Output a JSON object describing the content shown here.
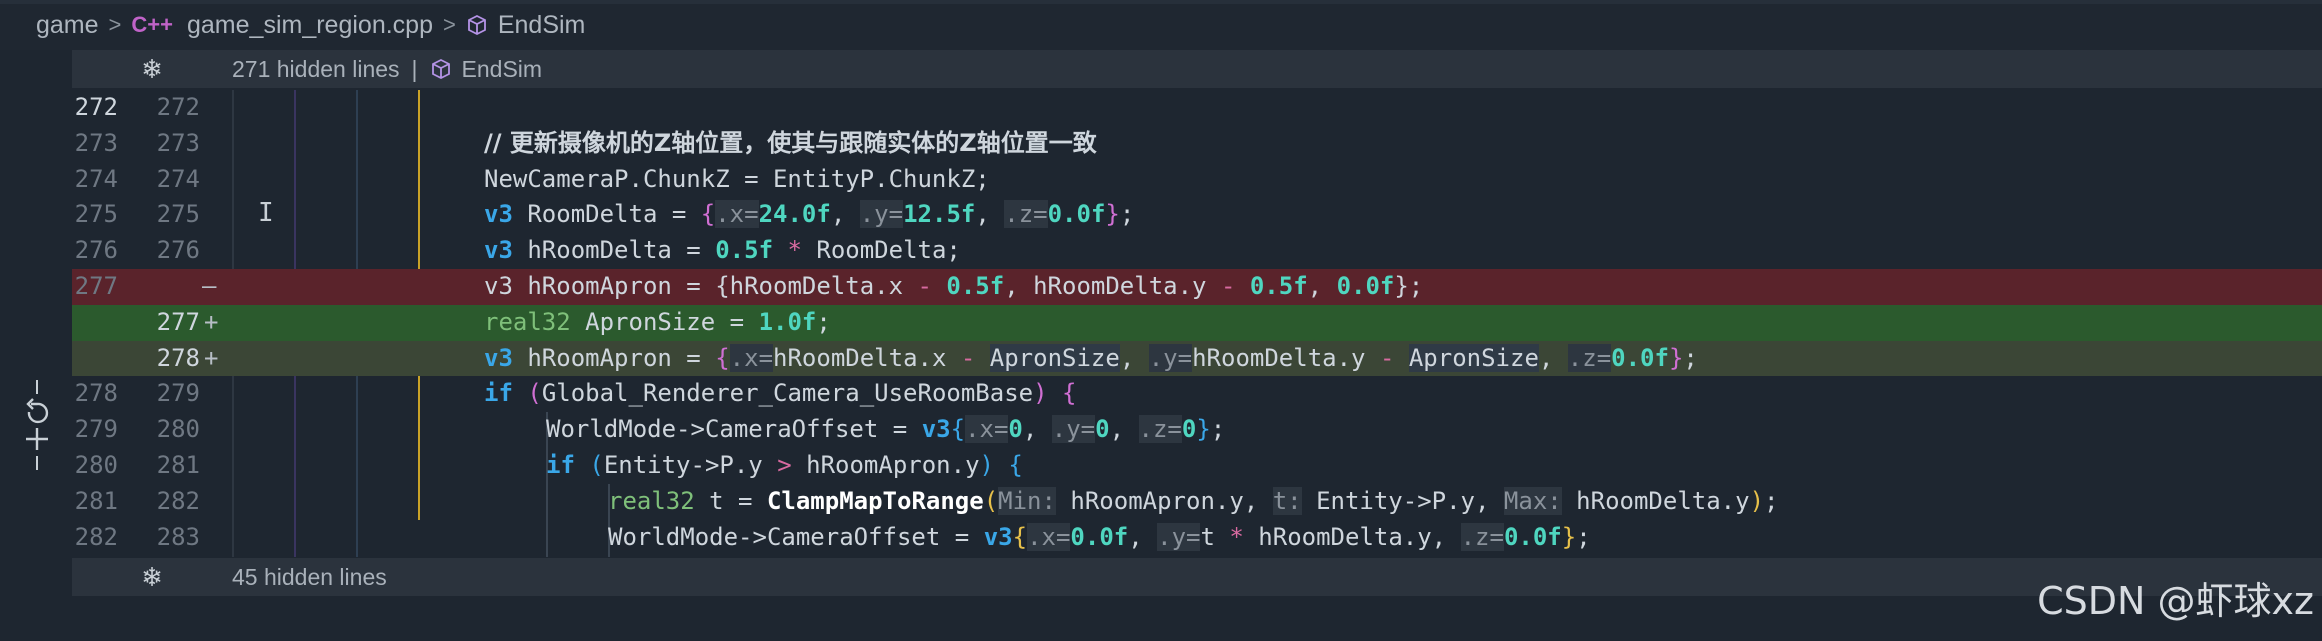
{
  "breadcrumb": {
    "folder": "game",
    "file_icon": "C++",
    "file": "game_sim_region.cpp",
    "symbol": "EndSim"
  },
  "fold_top": {
    "text": "271 hidden lines",
    "divider": "|",
    "symbol": "EndSim"
  },
  "fold_bottom": {
    "text": "45 hidden lines"
  },
  "watermark": "CSDN @虾球xz",
  "diff": {
    "deleted_marker": "—",
    "added_marker": "+"
  },
  "lines": {
    "l272": {
      "old": "272",
      "new": "272"
    },
    "l273": {
      "old": "273",
      "new": "273",
      "comment": "// 更新摄像机的Z轴位置，使其与跟随实体的Z轴位置一致"
    },
    "l274": {
      "old": "274",
      "new": "274",
      "code": "NewCameraP.ChunkZ = EntityP.ChunkZ;"
    },
    "l275": {
      "old": "275",
      "new": "275"
    },
    "l276": {
      "old": "276",
      "new": "276"
    },
    "l277d": {
      "old": "277"
    },
    "l277a": {
      "new": "277"
    },
    "l278a": {
      "new": "278"
    },
    "l278": {
      "old": "278",
      "new": "279"
    },
    "l279": {
      "old": "279",
      "new": "280"
    },
    "l280": {
      "old": "280",
      "new": "281"
    },
    "l281": {
      "old": "281",
      "new": "282"
    },
    "l282": {
      "old": "282",
      "new": "283"
    }
  },
  "tokens": {
    "v3": "v3",
    "real32": "real32",
    "RoomDelta": "RoomDelta",
    "hRoomDelta": "hRoomDelta",
    "hRoomApron": "hRoomApron",
    "ApronSize": "ApronSize",
    "if": "if",
    "cond1": "Global_Renderer_Camera_UseRoomBase",
    "cameraOffset": "WorldMode->CameraOffset",
    "entityPy": "Entity->P.y",
    "hRoomApronY": "hRoomApron.y",
    "clamp": "ClampMapToRange",
    "hint_min": "Min:",
    "hint_t": "t:",
    "hint_max": "Max:",
    "hint_x": ".x=",
    "hint_y": ".y=",
    "hint_z": ".z="
  },
  "colors": {
    "background": "#1e2630",
    "deleted_line": "#5a232b",
    "added_line": "#2b5a2d",
    "keyword": "#3aa7e8",
    "number": "#4fd6c0",
    "type": "#7fc07a"
  }
}
